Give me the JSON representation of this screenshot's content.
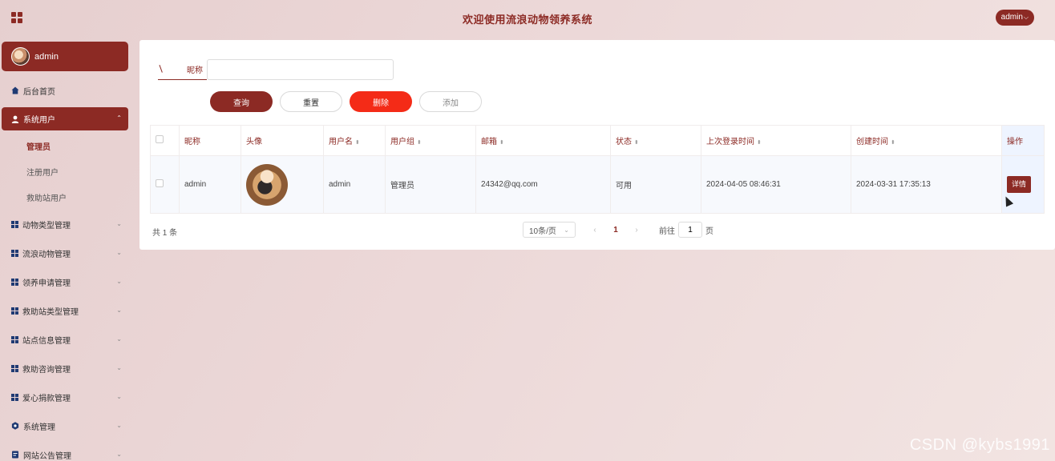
{
  "header": {
    "title": "欢迎使用流浪动物领养系统",
    "user_label": "admin"
  },
  "sidebar": {
    "profile_name": "admin",
    "items": [
      {
        "label": "后台首页"
      },
      {
        "label": "系统用户",
        "active": true,
        "children": [
          {
            "label": "管理员",
            "current": true
          },
          {
            "label": "注册用户"
          },
          {
            "label": "救助站用户"
          }
        ]
      },
      {
        "label": "动物类型管理"
      },
      {
        "label": "流浪动物管理"
      },
      {
        "label": "领养申请管理"
      },
      {
        "label": "救助站类型管理"
      },
      {
        "label": "站点信息管理"
      },
      {
        "label": "救助咨询管理"
      },
      {
        "label": "爱心捐款管理"
      },
      {
        "label": "系统管理"
      },
      {
        "label": "网站公告管理"
      }
    ]
  },
  "search": {
    "label": "昵称",
    "value": ""
  },
  "buttons": {
    "query": "查询",
    "reset": "重置",
    "delete": "删除",
    "add": "添加"
  },
  "table": {
    "headers": [
      "昵称",
      "头像",
      "用户名",
      "用户组",
      "邮箱",
      "状态",
      "上次登录时间",
      "创建时间",
      "操作"
    ],
    "rows": [
      {
        "nickname": "admin",
        "username": "admin",
        "group": "管理员",
        "email": "24342@qq.com",
        "status": "可用",
        "last_login": "2024-04-05 08:46:31",
        "created": "2024-03-31 17:35:13",
        "action": "详情"
      }
    ]
  },
  "pagination": {
    "total": "共 1 条",
    "page_size": "10条/页",
    "current_page": "1",
    "goto_prefix": "前往",
    "goto_value": "1",
    "goto_suffix": "页"
  },
  "watermark": "CSDN @kybs1991",
  "colors": {
    "primary": "#8c2a24",
    "danger": "#f42b17"
  }
}
